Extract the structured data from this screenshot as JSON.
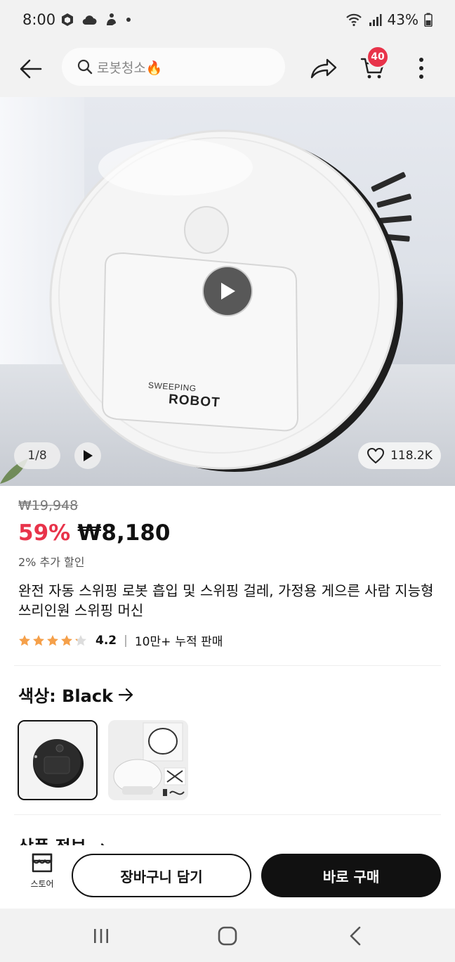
{
  "status_bar": {
    "time": "8:00",
    "battery": "43%",
    "icons": [
      "app-icon",
      "cloud-icon",
      "person-icon",
      "dot-icon",
      "wifi-icon",
      "signal-icon",
      "battery-icon"
    ]
  },
  "top_nav": {
    "search_query": "로봇청소🔥",
    "cart_count": "40"
  },
  "image": {
    "counter": "1/8",
    "likes": "118.2K",
    "brand_small": "SWEEPING",
    "brand_large": "ROBOT"
  },
  "product": {
    "original_price": "₩19,948",
    "discount": "59%",
    "price": "₩8,180",
    "extra_discount": "2% 추가 할인",
    "title": "완전 자동 스위핑 로봇 흡입 및 스위핑 걸레, 가정용 게으른 사람 지능형 쓰리인원 스위핑 머신",
    "rating": "4.2",
    "rating_stars": 4.2,
    "sold_count": "10만+",
    "sold_label": "누적 판매"
  },
  "color": {
    "label": "색상: Black",
    "options": [
      "Black",
      "White"
    ],
    "selected": "Black"
  },
  "info_section": {
    "label": "상품 정보"
  },
  "actions": {
    "store_label": "스토어",
    "add_to_cart": "장바구니 담기",
    "buy_now": "바로 구매"
  },
  "colors": {
    "accent": "#e8334a",
    "primary": "#111111",
    "star": "#f5a04a"
  }
}
